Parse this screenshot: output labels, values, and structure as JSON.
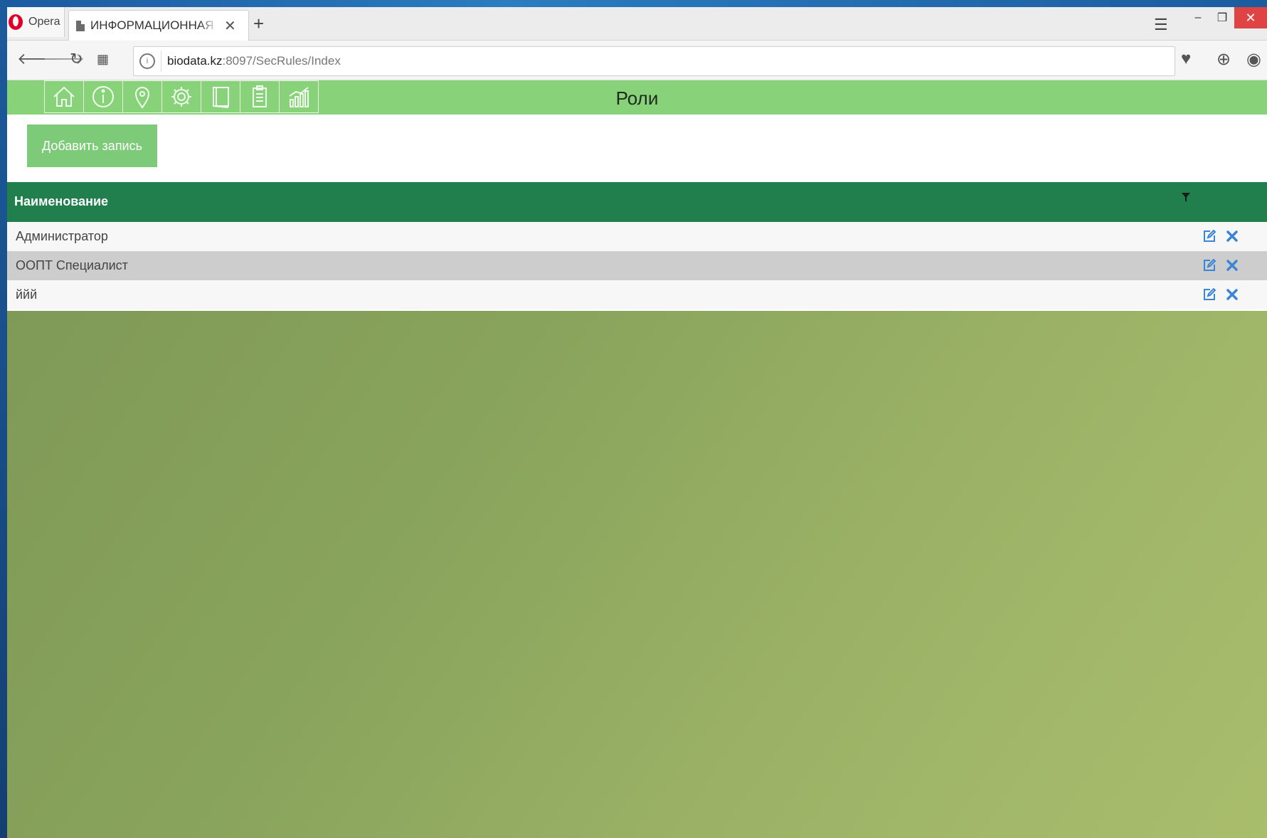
{
  "browser": {
    "menu_label": "Opera",
    "tab": {
      "title": "ИНФОРМАЦИОННАЯ СИ"
    },
    "new_tab_label": "+",
    "url": {
      "host": "biodata.kz",
      "path": ":8097/SecRules/Index"
    }
  },
  "app": {
    "header_icons": [
      "home-icon",
      "info-icon",
      "location-pin-icon",
      "settings-gear-icon",
      "book-icon",
      "clipboard-icon",
      "chart-icon"
    ],
    "page_title": "Роли",
    "add_button_label": "Добавить запись",
    "grid": {
      "column_header": "Наименование",
      "rows": [
        {
          "name": "Администратор"
        },
        {
          "name": "ООПТ Специалист"
        },
        {
          "name": "ййй"
        }
      ]
    }
  },
  "colors": {
    "header_green": "#88d27a",
    "grid_header_green": "#207f4c",
    "button_green": "#7dcb79",
    "row_alt_gray": "#cdcdcd",
    "action_blue": "#3a85d6"
  }
}
